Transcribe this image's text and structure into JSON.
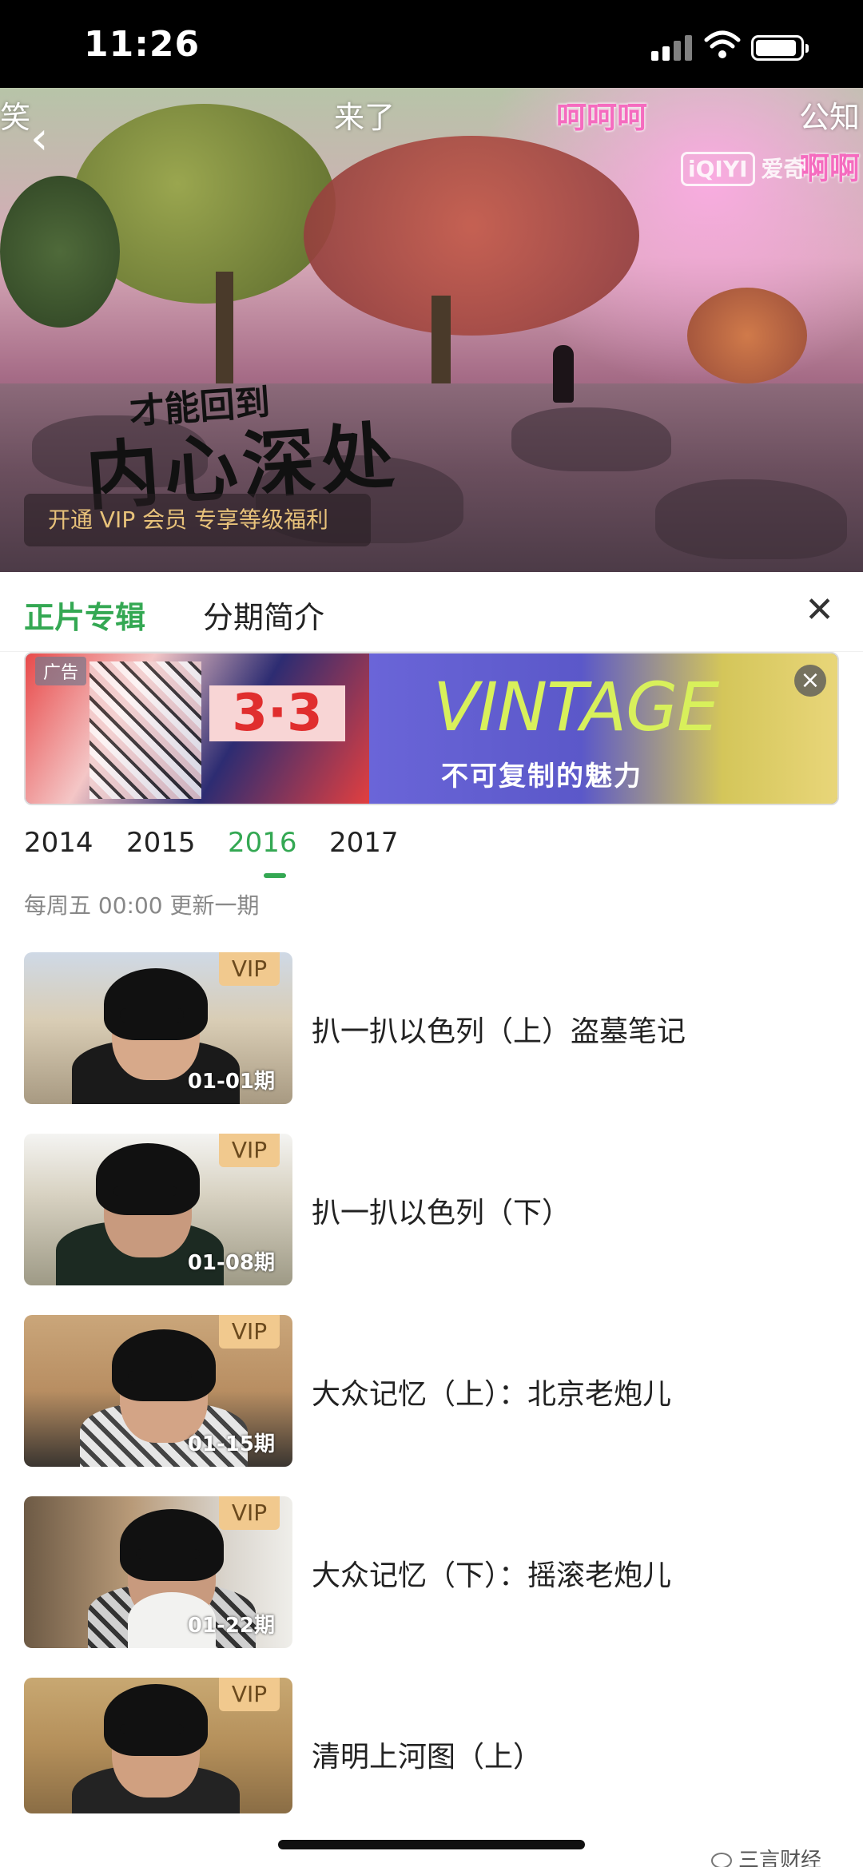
{
  "status_bar": {
    "time": "11:26"
  },
  "video": {
    "danmaku": [
      "笑",
      "来了",
      "呵呵呵",
      "公知",
      "啊啊"
    ],
    "logo_text": "爱奇",
    "logo_box": "iQIYI",
    "title_small": "才能回到",
    "title_big": "内心深处",
    "vip_promo": "开通 VIP 会员 专享等级福利"
  },
  "tabs": {
    "active": "正片专辑",
    "other": "分期简介"
  },
  "ad": {
    "tag": "广告",
    "left_text": "3·3",
    "headline": "VINTAGE",
    "slogan": "不可复制的魅力"
  },
  "years": [
    "2014",
    "2015",
    "2016",
    "2017"
  ],
  "selected_year": "2016",
  "update_note": "每周五 00:00 更新一期",
  "episodes": [
    {
      "badge": "VIP",
      "date": "01-01期",
      "title": "扒一扒以色列（上）盗墓笔记"
    },
    {
      "badge": "VIP",
      "date": "01-08期",
      "title": "扒一扒以色列（下）"
    },
    {
      "badge": "VIP",
      "date": "01-15期",
      "title": "大众记忆（上）：北京老炮儿"
    },
    {
      "badge": "VIP",
      "date": "01-22期",
      "title": "大众记忆（下）：摇滚老炮儿"
    },
    {
      "badge": "VIP",
      "date": "",
      "title": "清明上河图（上）"
    }
  ],
  "watermark": "三言财经",
  "colors": {
    "accent_green": "#34a853",
    "vip_gold": "#f1c98e"
  }
}
